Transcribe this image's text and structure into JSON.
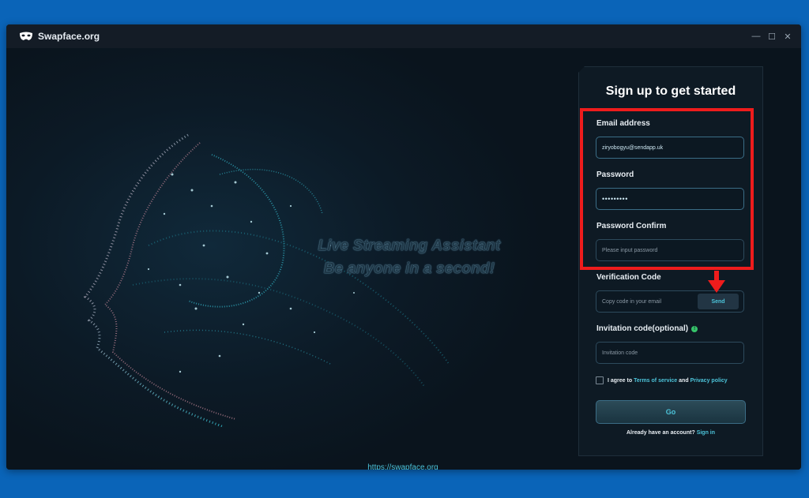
{
  "window": {
    "title": "Swapface.org",
    "controls": {
      "minimize": "—",
      "maximize": "☐",
      "close": "✕"
    }
  },
  "hero": {
    "tagline_line1": "Live Streaming Assistant",
    "tagline_line2": "Be anyone in a second!",
    "url": "https://swapface.org"
  },
  "signup": {
    "title": "Sign up to get started",
    "email": {
      "label": "Email address",
      "value": "ziryobogyu@sendapp.uk"
    },
    "password": {
      "label": "Password",
      "value": "•••••••••"
    },
    "password_confirm": {
      "label": "Password Confirm",
      "placeholder": "Please input password"
    },
    "verification": {
      "label": "Verification Code",
      "placeholder": "Copy code in your email",
      "send_label": "Send"
    },
    "invitation": {
      "label": "Invitation code(optional)",
      "placeholder": "Invitation code",
      "info_icon": "!"
    },
    "agree": {
      "prefix": "I agree to",
      "terms": "Terms of service",
      "and": "and",
      "privacy": "Privacy policy"
    },
    "go_label": "Go",
    "already": {
      "text": "Already have an account?",
      "link": "Sign in"
    }
  },
  "colors": {
    "accent": "#4cc3d9",
    "highlight": "#ee1c1c",
    "background": "#0a64b8"
  }
}
